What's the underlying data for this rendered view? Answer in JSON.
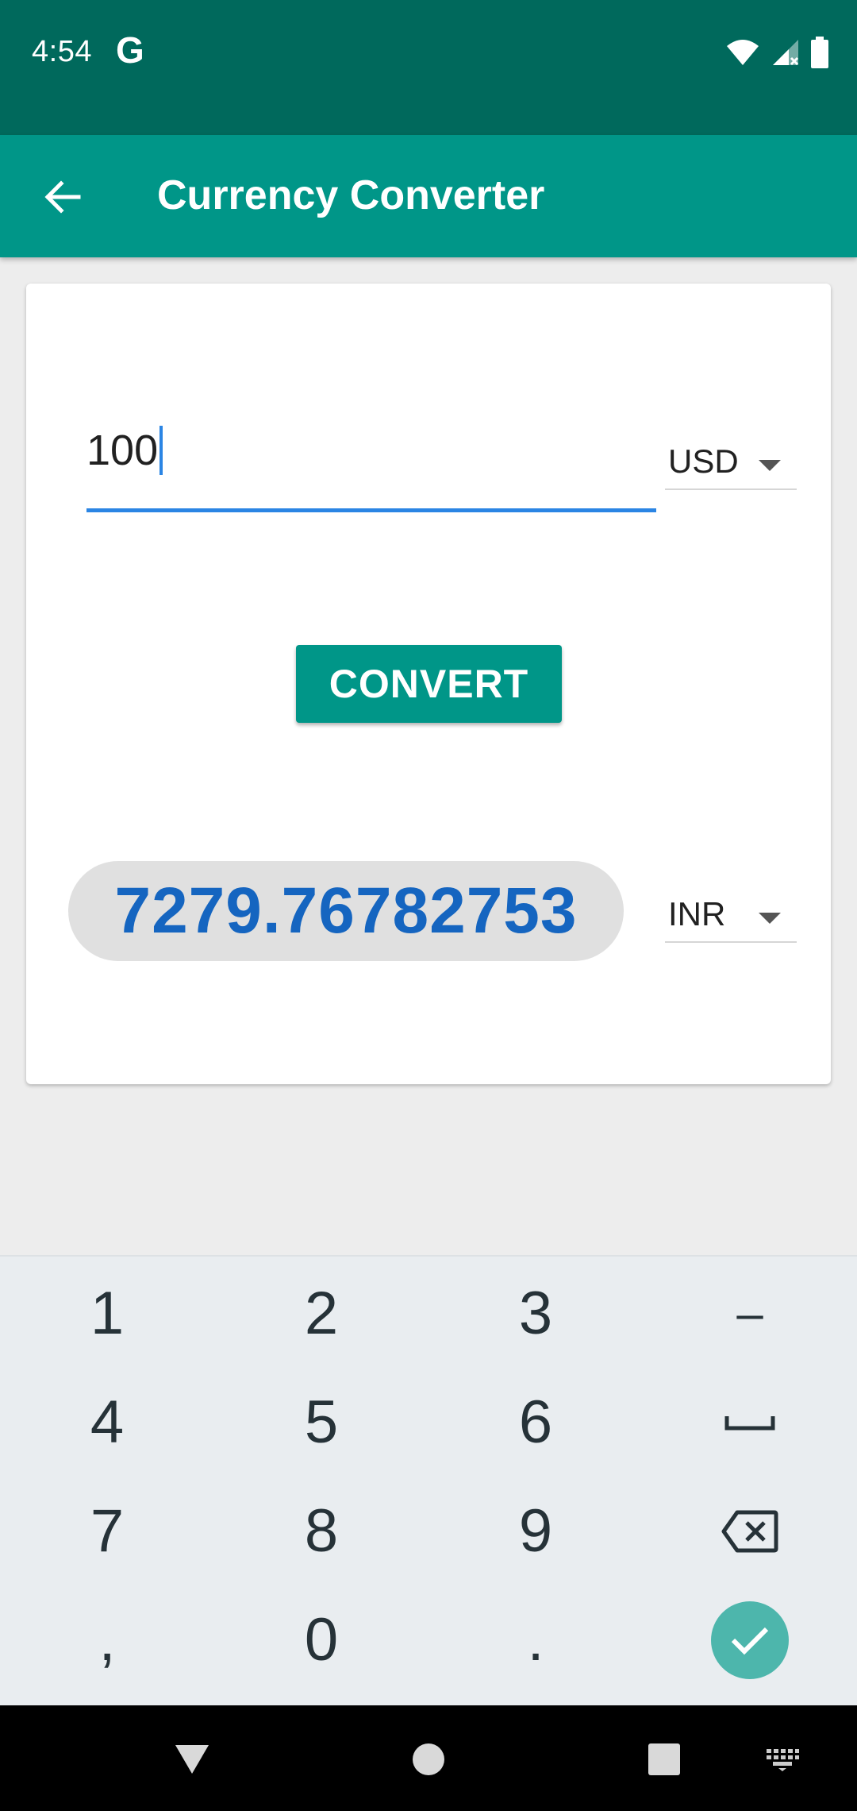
{
  "status_bar": {
    "time": "4:54",
    "g_logo": "G",
    "icons": [
      "wifi-icon",
      "signal-icon",
      "battery-icon"
    ]
  },
  "app_bar": {
    "title": "Currency Converter",
    "back_icon": "arrow-back-icon"
  },
  "converter": {
    "amount_value": "100",
    "from_currency": "USD",
    "convert_label": "CONVERT",
    "result_value": "7279.76782753",
    "to_currency": "INR"
  },
  "keyboard": {
    "rows": [
      [
        "1",
        "2",
        "3",
        "–"
      ],
      [
        "4",
        "5",
        "6",
        "space"
      ],
      [
        "7",
        "8",
        "9",
        "backspace"
      ],
      [
        ",",
        "0",
        ".",
        "done"
      ]
    ]
  },
  "nav_bar": {
    "icons": [
      "back-triangle-icon",
      "home-circle-icon",
      "recents-square-icon",
      "keyboard-switch-icon"
    ]
  },
  "colors": {
    "status_bar": "#00695c",
    "app_bar": "#009688",
    "accent": "#2b85e4",
    "result_text": "#1565c0",
    "done_key": "#4db6ac"
  }
}
